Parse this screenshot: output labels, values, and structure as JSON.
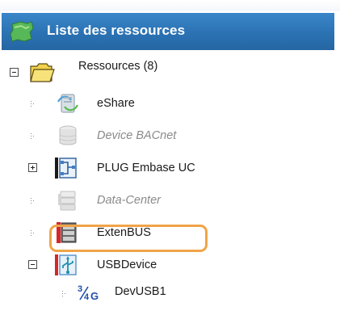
{
  "header": {
    "title": "Liste des ressources",
    "icon": "resources-tree-icon",
    "colors": {
      "background": "#2b72b3",
      "text": "#ffffff"
    }
  },
  "tree": {
    "root": {
      "label": "Ressources (8)",
      "expanded": true,
      "icon": "folder-icon"
    },
    "items": [
      {
        "label": "eShare",
        "disabled": false,
        "icon": "server-share-icon",
        "expandable": false
      },
      {
        "label": "Device BACnet",
        "disabled": true,
        "icon": "database-disabled-icon",
        "expandable": false
      },
      {
        "label": "PLUG Embase UC",
        "disabled": false,
        "icon": "plug-network-icon",
        "expandable": true,
        "expanded": false
      },
      {
        "label": "Data-Center",
        "disabled": true,
        "icon": "datacenter-disabled-icon",
        "expandable": false
      },
      {
        "label": "ExtenBUS",
        "disabled": false,
        "icon": "bus-module-icon",
        "expandable": false
      },
      {
        "label": "USBDevice",
        "disabled": false,
        "icon": "usb-device-icon",
        "expandable": true,
        "expanded": true
      }
    ],
    "children": [
      {
        "label": "DevUSB1",
        "icon": "3g-4g-modem-icon",
        "highlighted": true
      }
    ]
  },
  "colors": {
    "highlight": "#f0a448",
    "disabled_text": "#8a8a8a"
  }
}
